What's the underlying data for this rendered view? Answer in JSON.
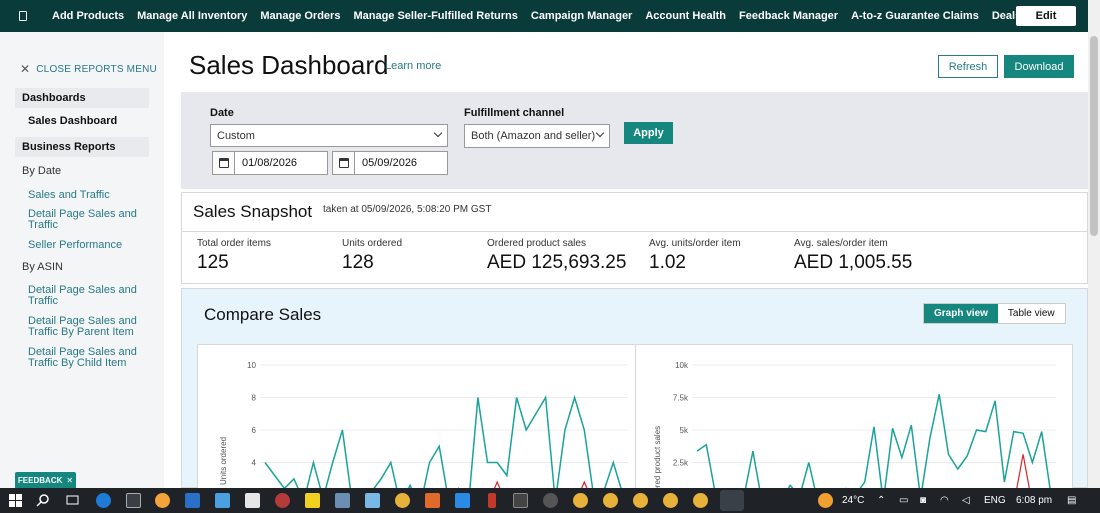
{
  "topbar": {
    "nav": [
      "Add Products",
      "Manage All Inventory",
      "Manage Orders",
      "Manage Seller-Fulfilled Returns",
      "Campaign Manager",
      "Account Health",
      "Feedback Manager",
      "A-to-z Guarantee Claims",
      "Deals"
    ],
    "edit_label": "Edit"
  },
  "sidebar": {
    "close_label": "CLOSE REPORTS MENU",
    "dashboards_label": "Dashboards",
    "sales_dashboard": "Sales Dashboard",
    "business_reports_label": "Business Reports",
    "by_date_label": "By Date",
    "by_date_items": [
      "Sales and Traffic",
      "Detail Page Sales and Traffic",
      "Seller Performance"
    ],
    "by_asin_label": "By ASIN",
    "by_asin_items": [
      "Detail Page Sales and Traffic",
      "Detail Page Sales and Traffic By Parent Item",
      "Detail Page Sales and Traffic By Child Item"
    ]
  },
  "feedback_label": "FEEDBACK",
  "header": {
    "title": "Sales Dashboard",
    "learn_more": "Learn more",
    "refresh": "Refresh",
    "download": "Download"
  },
  "filters": {
    "date_label": "Date",
    "date_value": "Custom",
    "start_date": "01/08/2026",
    "end_date": "05/09/2026",
    "channel_label": "Fulfillment channel",
    "channel_value": "Both (Amazon and seller)",
    "apply": "Apply"
  },
  "snapshot": {
    "title": "Sales Snapshot",
    "taken": "taken at 05/09/2026, 5:08:20 PM GST",
    "metrics": [
      {
        "label": "Total order items",
        "value": "125"
      },
      {
        "label": "Units ordered",
        "value": "128"
      },
      {
        "label": "Ordered product sales",
        "value": "AED 125,693.25"
      },
      {
        "label": "Avg. units/order item",
        "value": "1.02"
      },
      {
        "label": "Avg. sales/order item",
        "value": "AED 1,005.55"
      }
    ]
  },
  "compare": {
    "title": "Compare Sales",
    "graph_view": "Graph view",
    "table_view": "Table view"
  },
  "chart_data": [
    {
      "type": "line",
      "ylabel": "Units ordered",
      "yticks": [
        "10",
        "8",
        "6",
        "4"
      ],
      "ylim": [
        2,
        10
      ],
      "series": [
        {
          "color": "#1aa39a",
          "values": [
            4,
            3.2,
            2.4,
            3,
            1.6,
            4,
            1.8,
            4,
            6,
            1.6,
            1.4,
            2.2,
            3,
            4,
            1.4,
            2.6,
            1.2,
            4,
            5,
            1.6,
            2.4,
            1.2,
            8,
            4,
            4,
            3.2,
            8,
            6,
            7,
            8,
            1.6,
            6,
            8,
            6,
            1.8,
            2.2,
            4,
            2
          ]
        },
        {
          "color": "#d62728",
          "values": [
            0,
            0,
            0,
            0,
            0,
            0,
            0,
            0,
            0,
            0,
            0,
            0,
            0,
            0,
            0,
            0,
            0,
            0,
            0,
            0,
            0,
            0,
            0,
            0,
            2.8,
            0,
            0,
            0,
            0,
            0,
            0,
            0,
            0,
            2.8,
            0,
            0,
            0,
            0
          ]
        }
      ]
    },
    {
      "type": "line",
      "ylabel": "Ordered product sales",
      "yticks": [
        "10k",
        "7.5k",
        "5k",
        "2.5k"
      ],
      "ylim": [
        2000,
        10000
      ],
      "series": [
        {
          "color": "#1aa39a",
          "values": [
            4700,
            5100,
            2000,
            1500,
            2200,
            1800,
            4700,
            1500,
            2200,
            1600,
            2600,
            1900,
            4000,
            1500,
            1900,
            1500,
            2400,
            2000,
            2800,
            6200,
            1600,
            6100,
            4300,
            6300,
            1800,
            5500,
            8200,
            4500,
            3600,
            4400,
            6000,
            5900,
            7800,
            2800,
            5900,
            5800,
            4000,
            5900,
            2000
          ]
        },
        {
          "color": "#d62728",
          "values": [
            0,
            0,
            0,
            0,
            0,
            0,
            0,
            0,
            0,
            0,
            0,
            0,
            0,
            0,
            0,
            0,
            0,
            0,
            0,
            0,
            0,
            0,
            0,
            0,
            0,
            0,
            0,
            0,
            0,
            0,
            0,
            0,
            0,
            0,
            0,
            4500,
            0,
            0,
            0
          ]
        }
      ]
    }
  ],
  "taskbar": {
    "weather": "24°C",
    "lang": "ENG",
    "time": "6:08 pm"
  }
}
